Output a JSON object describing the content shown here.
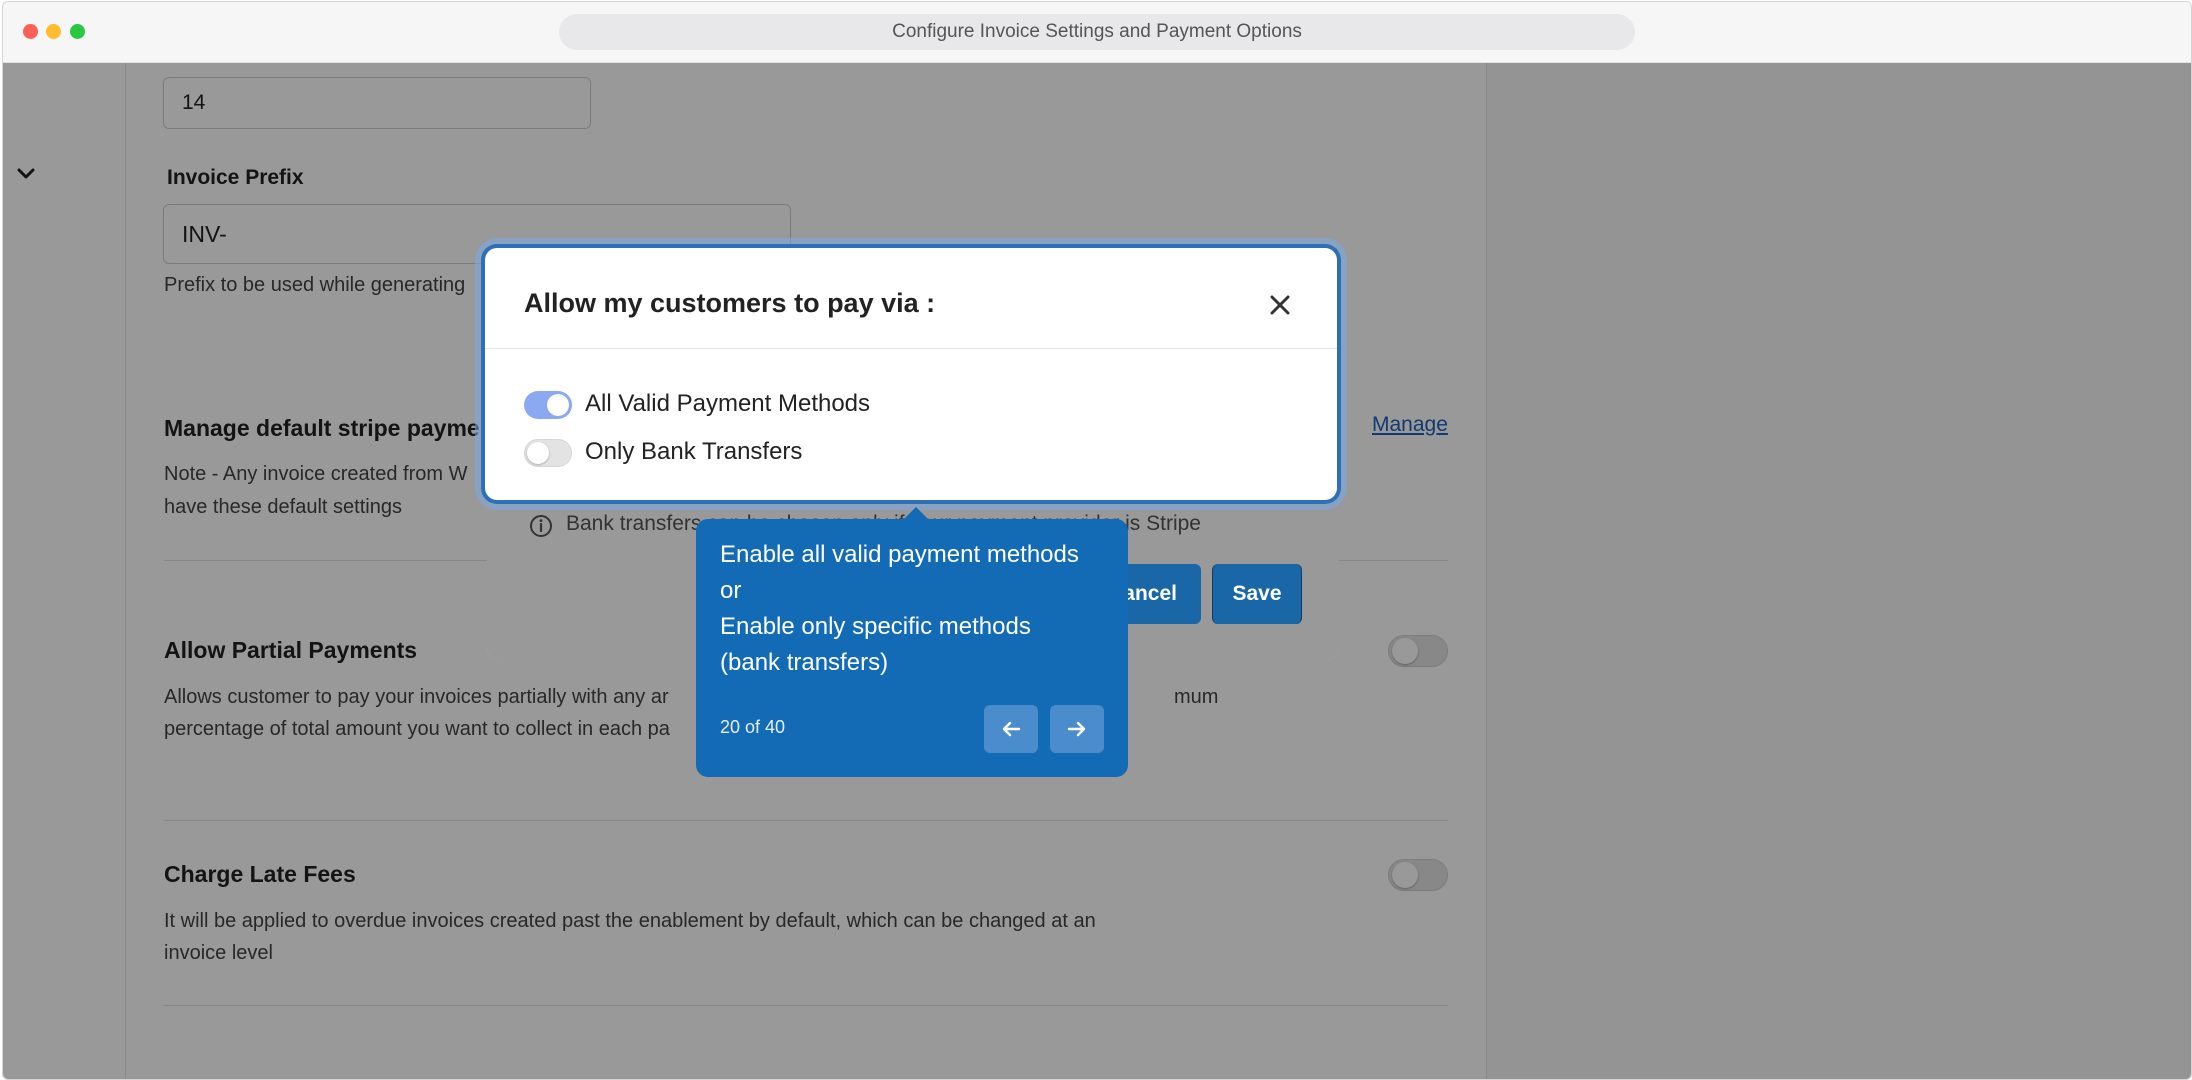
{
  "window": {
    "title": "Configure Invoice Settings and Payment Options"
  },
  "form": {
    "days_value": "14",
    "invoice_prefix": {
      "label": "Invoice Prefix",
      "value": "INV-",
      "help": "Prefix to be used while generating"
    },
    "stripe": {
      "title": "Manage default stripe payme",
      "note_line1": "Note - Any invoice created from W",
      "note_line2": "have these default settings",
      "manage_link": "Manage"
    },
    "partial_payments": {
      "title": "Allow Partial Payments",
      "desc_line1_a": "Allows customer to pay your invoices partially with any ar",
      "desc_line1_b": "mum",
      "desc_line2": "percentage of total amount you want to collect in each pa",
      "enabled": false
    },
    "late_fees": {
      "title": "Charge Late Fees",
      "desc_line1": "It will be applied to overdue invoices created past the enablement by default, which can be changed at an",
      "desc_line2": "invoice level",
      "enabled": false
    }
  },
  "modal": {
    "title": "Allow my customers to pay via :",
    "options": [
      {
        "label": "All Valid Payment Methods",
        "enabled": true
      },
      {
        "label": "Only Bank Transfers",
        "enabled": false
      }
    ],
    "info_text": "Bank transfers can be chosen only if your payment provider is Stripe",
    "cancel_label": "ancel",
    "save_label": "Save"
  },
  "tooltip": {
    "lines": [
      "Enable all valid payment methods",
      "or",
      "Enable only specific methods",
      "(bank transfers)"
    ],
    "step": "20 of 40"
  },
  "colors": {
    "accent": "#136bb6",
    "button": "#1a67a8",
    "toggle_on": "#8aa9f0"
  }
}
